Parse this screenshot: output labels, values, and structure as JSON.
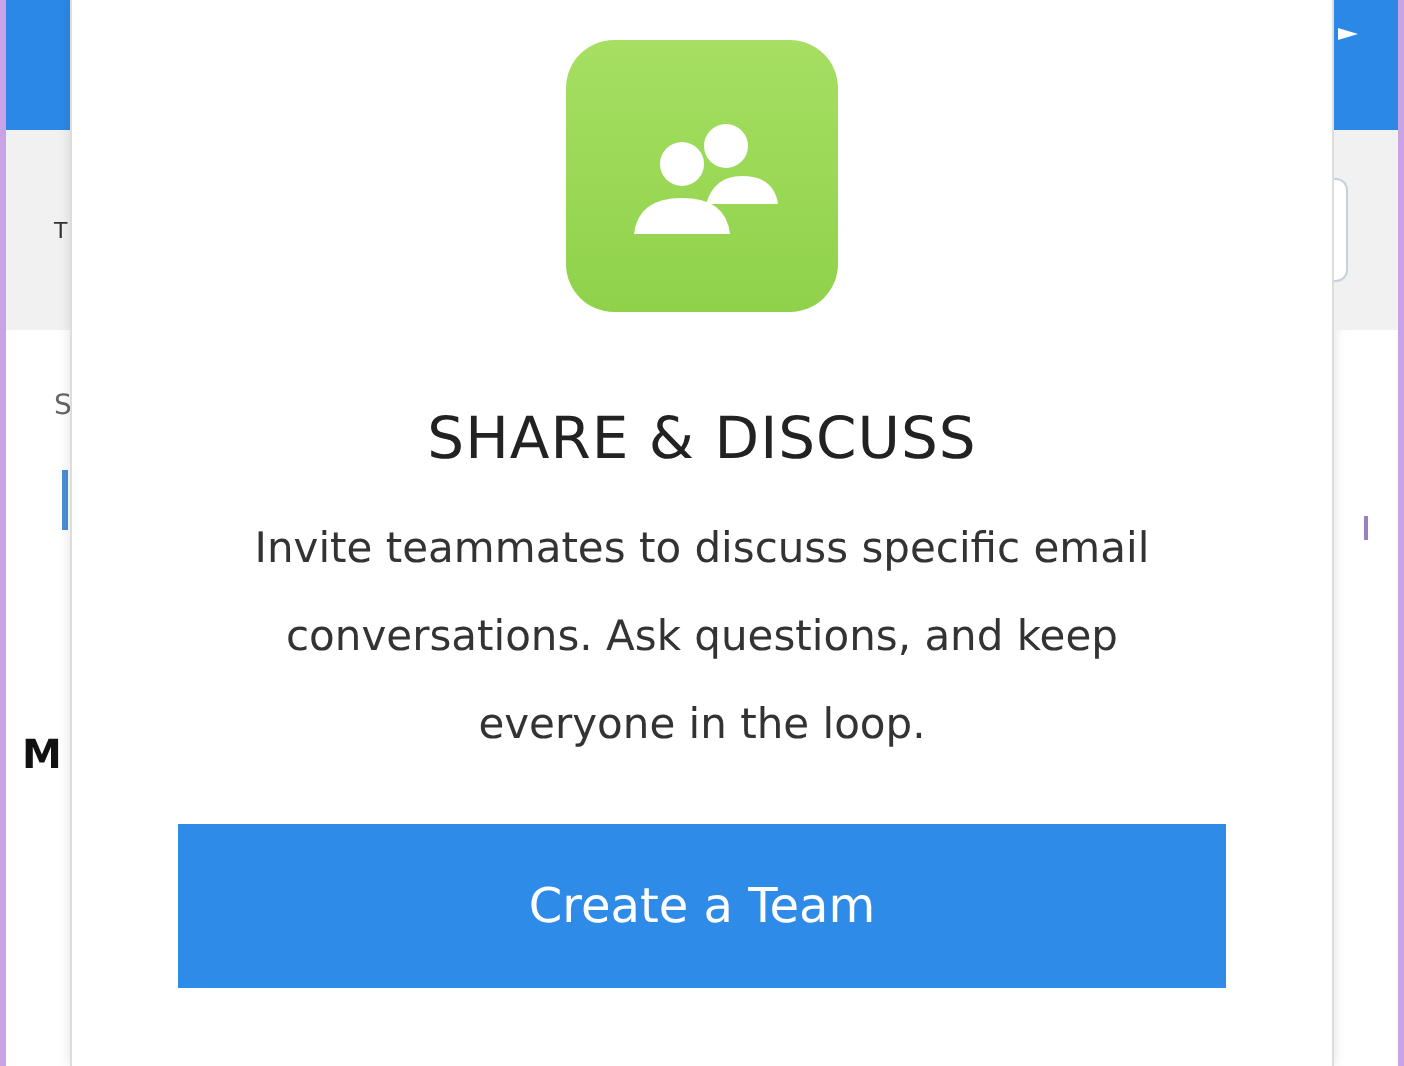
{
  "background_app": {
    "left_texts": [
      "T",
      "S",
      "M"
    ]
  },
  "dialog": {
    "title": "SHARE & DISCUSS",
    "description": "Invite teammates to discuss specific email conversations. Ask questions, and keep everyone in the loop.",
    "button": "Create a Team"
  }
}
